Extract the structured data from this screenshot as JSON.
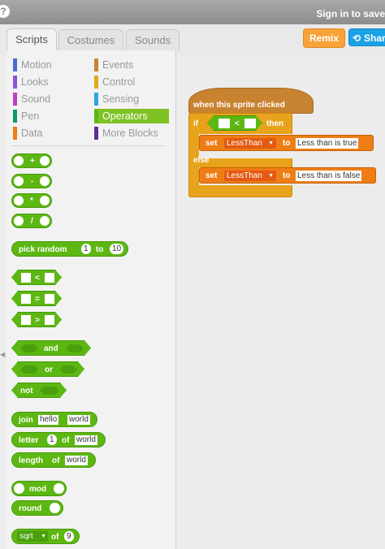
{
  "topbar": {
    "help_icon": "?",
    "signin_text": "Sign in to save"
  },
  "tabs": [
    {
      "label": "Scripts",
      "active": true
    },
    {
      "label": "Costumes"
    },
    {
      "label": "Sounds"
    }
  ],
  "actions": {
    "remix_label": "Remix",
    "share_label": "Share"
  },
  "categories": {
    "left": [
      {
        "label": "Motion",
        "color": "#4a6cd4"
      },
      {
        "label": "Looks",
        "color": "#8a55d7"
      },
      {
        "label": "Sound",
        "color": "#bb42c3"
      },
      {
        "label": "Pen",
        "color": "#0e9a6c"
      },
      {
        "label": "Data",
        "color": "#ee7d16"
      }
    ],
    "right": [
      {
        "label": "Events",
        "color": "#c88330"
      },
      {
        "label": "Control",
        "color": "#e1a91a"
      },
      {
        "label": "Sensing",
        "color": "#2ca5e2"
      },
      {
        "label": "Operators",
        "color": "#5cb712",
        "selected": true
      },
      {
        "label": "More Blocks",
        "color": "#632d99"
      }
    ]
  },
  "palette": {
    "plus": "+",
    "minus": "-",
    "times": "*",
    "divide": "/",
    "pick_random": "pick random",
    "pick_from": "1",
    "pick_to_word": "to",
    "pick_to": "10",
    "lt": "<",
    "eq": "=",
    "gt": ">",
    "and": "and",
    "or": "or",
    "not": "not",
    "join": "join",
    "join_a": "hello",
    "join_b": "world",
    "letter": "letter",
    "letter_n": "1",
    "letter_of": "of",
    "letter_word": "world",
    "length": "length",
    "length_of": "of",
    "length_word": "world",
    "mod": "mod",
    "round": "round",
    "sqrt": "sqrt",
    "sqrt_of": "of",
    "sqrt_n": "9"
  },
  "script": {
    "hat": "when this sprite clicked",
    "if": "if",
    "lt": "<",
    "then": "then",
    "else": "else",
    "set1": {
      "set": "set",
      "var": "LessThan",
      "to": "to",
      "value": "Less than is true"
    },
    "set2": {
      "set": "set",
      "var": "LessThan",
      "to": "to",
      "value": "Less than is false"
    }
  }
}
